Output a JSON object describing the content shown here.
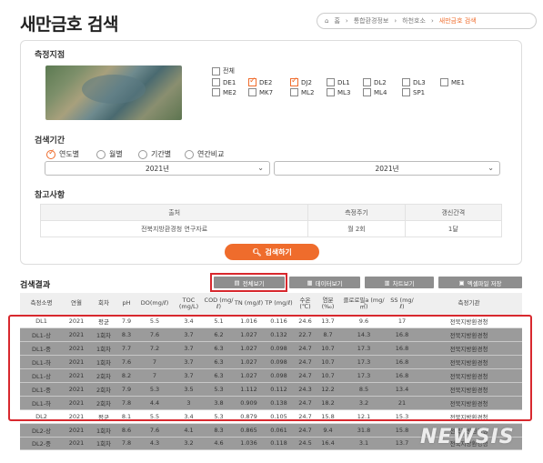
{
  "page": {
    "title": "새만금호 검색"
  },
  "breadcrumb": [
    "홈",
    "통합환경정보",
    "하천호소",
    "새만금호 검색"
  ],
  "station": {
    "title": "측정지점",
    "all_label": "전체",
    "items": [
      {
        "label": "DE1",
        "checked": false
      },
      {
        "label": "DE2",
        "checked": true
      },
      {
        "label": "DJ2",
        "checked": true
      },
      {
        "label": "DL1",
        "checked": false
      },
      {
        "label": "DL2",
        "checked": false
      },
      {
        "label": "DL3",
        "checked": false
      },
      {
        "label": "ME1",
        "checked": false
      },
      {
        "label": "ME2",
        "checked": false
      },
      {
        "label": "MK7",
        "checked": false
      },
      {
        "label": "ML2",
        "checked": false
      },
      {
        "label": "ML3",
        "checked": false
      },
      {
        "label": "ML4",
        "checked": false
      },
      {
        "label": "SP1",
        "checked": false
      }
    ]
  },
  "period": {
    "title": "검색기간",
    "options": [
      {
        "label": "연도별",
        "selected": true
      },
      {
        "label": "월별",
        "selected": false
      },
      {
        "label": "기간별",
        "selected": false
      },
      {
        "label": "연간비교",
        "selected": false
      }
    ],
    "from_year": "2021년",
    "to_year": "2021년"
  },
  "reference": {
    "title": "참고사항",
    "headers": [
      "출처",
      "측정주기",
      "갱신간격"
    ],
    "row": [
      "전북지방환경청 연구자료",
      "월 2회",
      "1달"
    ]
  },
  "search_button": "검색하기",
  "results": {
    "title": "검색결과",
    "buttons": [
      "전체보기",
      "데이터보기",
      "차트보기",
      "엑셀파일 저장"
    ],
    "headers": [
      "측정소명",
      "연월",
      "회차",
      "pH",
      "DO(mg/ℓ)",
      "TOC (mg/L)",
      "COD (mg/ℓ)",
      "TN (mg/ℓ)",
      "TP (mg/ℓ)",
      "수온 (℃)",
      "염분 (‰)",
      "클로로필a (mg/㎥)",
      "SS (mg/ℓ)",
      "측정기관"
    ],
    "rows": [
      [
        "DL1",
        "2021",
        "평균",
        "7.9",
        "5.5",
        "3.4",
        "5.1",
        "1.016",
        "0.116",
        "24.6",
        "13.7",
        "9.6",
        "17",
        "전북지방환경청"
      ],
      [
        "DL1-상",
        "2021",
        "1회차",
        "8.3",
        "7.6",
        "3.7",
        "6.2",
        "1.027",
        "0.132",
        "22.7",
        "8.7",
        "14.3",
        "16.8",
        "전북지방환경청"
      ],
      [
        "DL1-중",
        "2021",
        "1회차",
        "7.7",
        "7.2",
        "3.7",
        "6.3",
        "1.027",
        "0.098",
        "24.7",
        "10.7",
        "17.3",
        "16.8",
        "전북지방환경청"
      ],
      [
        "DL1-하",
        "2021",
        "1회차",
        "7.6",
        "7",
        "3.7",
        "6.3",
        "1.027",
        "0.098",
        "24.7",
        "10.7",
        "17.3",
        "16.8",
        "전북지방환경청"
      ],
      [
        "DL1-상",
        "2021",
        "2회차",
        "8.2",
        "7",
        "3.7",
        "6.3",
        "1.027",
        "0.098",
        "24.7",
        "10.7",
        "17.3",
        "16.8",
        "전북지방환경청"
      ],
      [
        "DL1-중",
        "2021",
        "2회차",
        "7.9",
        "5.3",
        "3.5",
        "5.3",
        "1.112",
        "0.112",
        "24.3",
        "12.2",
        "8.5",
        "13.4",
        "전북지방환경청"
      ],
      [
        "DL1-하",
        "2021",
        "2회차",
        "7.8",
        "4.4",
        "3",
        "3.8",
        "0.909",
        "0.138",
        "24.7",
        "18.2",
        "3.2",
        "21",
        "전북지방환경청"
      ],
      [
        "DL2",
        "2021",
        "평균",
        "8.1",
        "5.5",
        "3.4",
        "5.3",
        "0.879",
        "0.105",
        "24.7",
        "15.8",
        "12.1",
        "15.3",
        "전북지방환경청"
      ],
      [
        "DL2-상",
        "2021",
        "1회차",
        "8.6",
        "7.6",
        "4.1",
        "8.3",
        "0.865",
        "0.061",
        "24.7",
        "9.4",
        "31.8",
        "15.8",
        "전북지방환경청"
      ],
      [
        "DL2-중",
        "2021",
        "1회차",
        "7.8",
        "4.3",
        "3.2",
        "4.6",
        "1.036",
        "0.118",
        "24.5",
        "16.4",
        "3.1",
        "13.7",
        "전북지방환경청"
      ]
    ]
  },
  "watermark": "NEWSIS"
}
